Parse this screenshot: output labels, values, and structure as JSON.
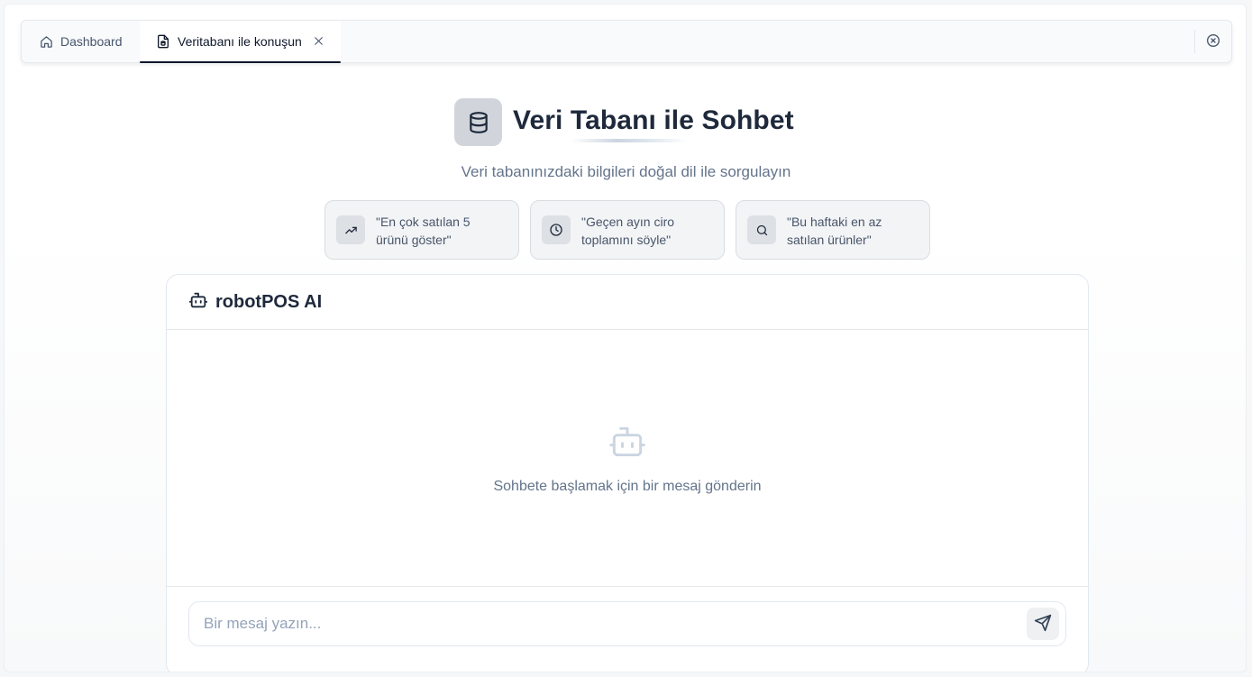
{
  "tabs": {
    "dashboard_label": "Dashboard",
    "active_label": "Veritabanı ile konuşun"
  },
  "hero": {
    "title": "Veri Tabanı ile Sohbet",
    "subtitle": "Veri tabanınızdaki bilgileri doğal dil ile sorgulayın",
    "icon": "database-icon"
  },
  "suggestions": [
    {
      "icon": "trending-up-icon",
      "line1": "\"En çok satılan 5",
      "line2": "ürünü göster\""
    },
    {
      "icon": "clock-icon",
      "line1": "\"Geçen ayın ciro",
      "line2": "toplamını söyle\""
    },
    {
      "icon": "search-icon",
      "line1": "\"Bu haftaki en az",
      "line2": "satılan ürünler\""
    }
  ],
  "chat": {
    "title": "robotPOS AI",
    "empty_text": "Sohbete başlamak için bir mesaj gönderin",
    "input_placeholder": "Bir mesaj yazın...",
    "input_value": ""
  },
  "colors": {
    "accent": "#0f172a",
    "muted_text": "#64748b",
    "border": "#e2e8f0"
  }
}
